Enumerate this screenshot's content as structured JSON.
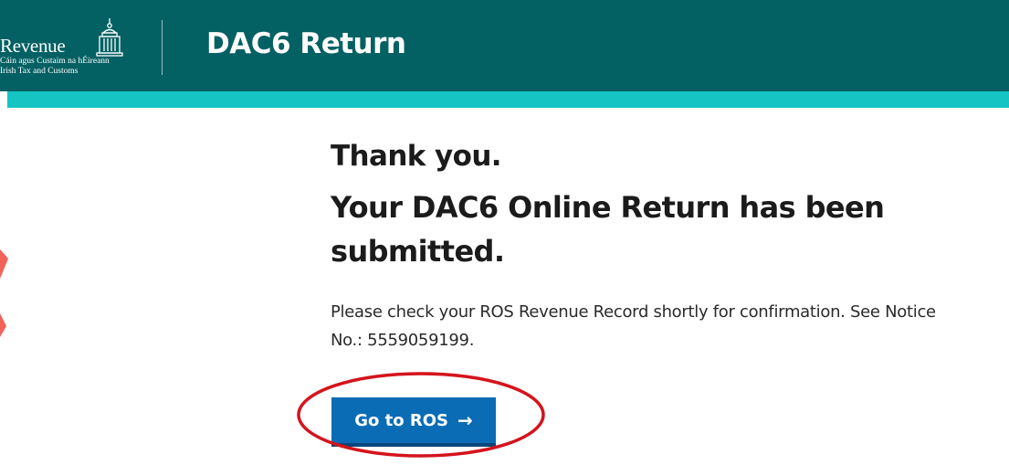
{
  "header": {
    "logo": {
      "wordmark": "Revenue",
      "subtitle_line1": "Cáin agus Custaim na hÉireann",
      "subtitle_line2": "Irish Tax and Customs",
      "icon": "custom-house-crest-icon"
    },
    "app_title": "DAC6 Return"
  },
  "main": {
    "thank_you": "Thank you.",
    "submitted_message": "Your DAC6 Online Return has been submitted.",
    "notice_text": "Please check your ROS Revenue Record shortly for confirmation. See Notice No.: 5559059199.",
    "go_button": {
      "label": "Go to ROS",
      "arrow": "→",
      "icon": "arrow-right-icon"
    }
  },
  "colors": {
    "header_bg": "#036063",
    "accent_bar": "#16c4c4",
    "button_bg": "#0a6cb5",
    "annotation": "#d4141c"
  }
}
